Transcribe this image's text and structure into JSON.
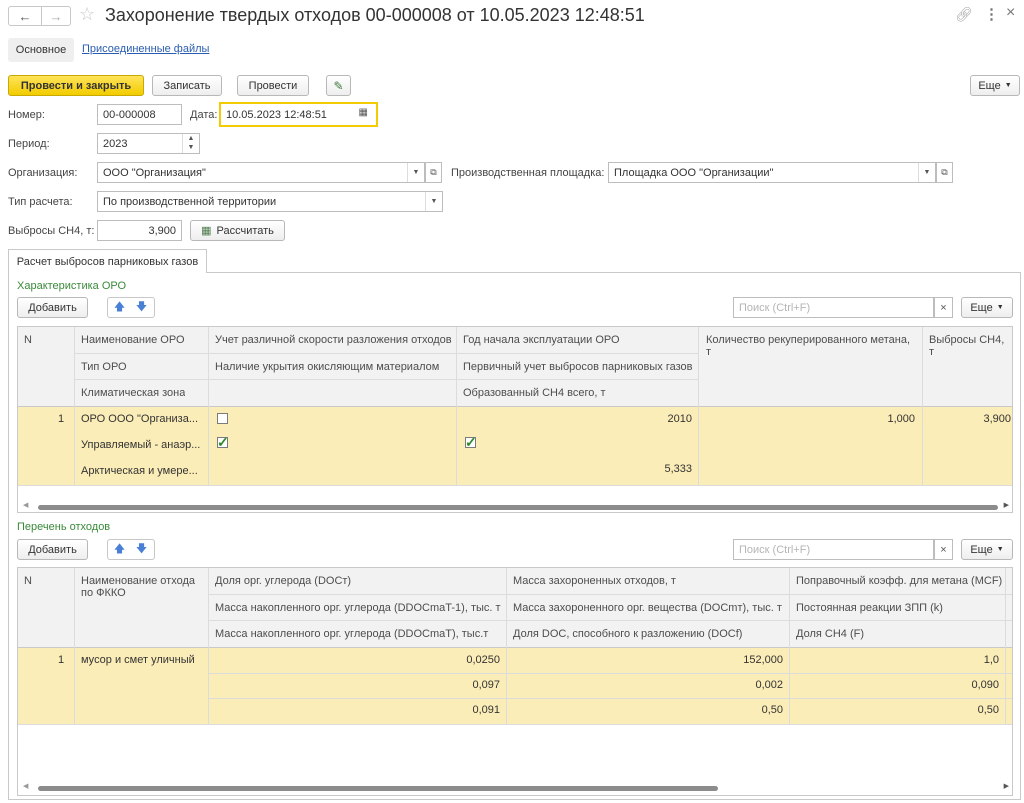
{
  "window": {
    "title": "Захоронение твердых отходов 00-000008 от 10.05.2023 12:48:51"
  },
  "tabs": {
    "main": "Основное",
    "files": "Присоединенные файлы"
  },
  "toolbar": {
    "post_close": "Провести и закрыть",
    "save": "Записать",
    "post": "Провести",
    "more": "Еще"
  },
  "form": {
    "number_label": "Номер:",
    "number_value": "00-000008",
    "date_label": "Дата:",
    "date_value": "10.05.2023 12:48:51",
    "period_label": "Период:",
    "period_value": "2023",
    "org_label": "Организация:",
    "org_value": "ООО \"Организация\"",
    "site_label": "Производственная площадка:",
    "site_value": "Площадка ООО \"Организации\"",
    "calc_type_label": "Тип расчета:",
    "calc_type_value": "По производственной территории",
    "emissions_label": "Выбросы CH4, т:",
    "emissions_value": "3,900",
    "calculate": "Рассчитать"
  },
  "section_tab": "Расчет выбросов парниковых газов",
  "oro": {
    "title": "Характеристика ОРО",
    "add": "Добавить",
    "search_placeholder": "Поиск (Ctrl+F)",
    "more": "Еще",
    "headers": {
      "n": "N",
      "name": "Наименование ОРО",
      "type": "Тип ОРО",
      "climate": "Климатическая зона",
      "decay": "Учет различной скорости разложения отходов",
      "cover": "Наличие укрытия окисляющим материалом",
      "year": "Год начала эксплуатации ОРО",
      "primary": "Первичный учет выбросов парниковых газов",
      "formed": "Образованный CH4 всего, т",
      "recovered_1": "Количество рекуперированного метана,",
      "recovered_2": "т",
      "emis_1": "Выбросы CH4,",
      "emis_2": "т"
    },
    "row": {
      "n": "1",
      "name": "ОРО ООО \"Организа...",
      "type": "Управляемый - анаэр...",
      "climate": "Арктическая и умере...",
      "year": "2010",
      "formed": "5,333",
      "recovered": "1,000",
      "emissions": "3,900"
    }
  },
  "waste": {
    "title": "Перечень отходов",
    "add": "Добавить",
    "search_placeholder": "Поиск (Ctrl+F)",
    "more": "Еще",
    "headers": {
      "n": "N",
      "name_1": "Наименование отхода",
      "name_2": "по ФККО",
      "c1r1": "Доля орг. углерода (DOCт)",
      "c1r2": "Масса накопленного орг. углерода (DDOCmaT-1), тыс. т",
      "c1r3": "Масса накопленного орг. углерода (DDOCmaT), тыс.т",
      "c2r1": "Масса захороненных отходов, т",
      "c2r2": "Масса захороненного орг. вещества (DOCmт), тыс. т",
      "c2r3": "Доля DOC, способного к разложению (DOCf)",
      "c3r1": "Поправочный коэфф. для метана (MCF)",
      "c3r2": "Постоянная реакции ЗПП (k)",
      "c3r3": "Доля CH4 (F)"
    },
    "row": {
      "n": "1",
      "name": "мусор и смет уличный",
      "c1r1": "0,0250",
      "c1r2": "0,097",
      "c1r3": "0,091",
      "c2r1": "152,000",
      "c2r2": "0,002",
      "c2r3": "0,50",
      "c3r1": "1,0",
      "c3r2": "0,090",
      "c3r3": "0,50"
    }
  },
  "colors": {
    "accent_yellow": "#f2cc00",
    "selected_row": "#fbedb8",
    "section_green": "#3a8a3a",
    "link_blue": "#2a5db0"
  }
}
